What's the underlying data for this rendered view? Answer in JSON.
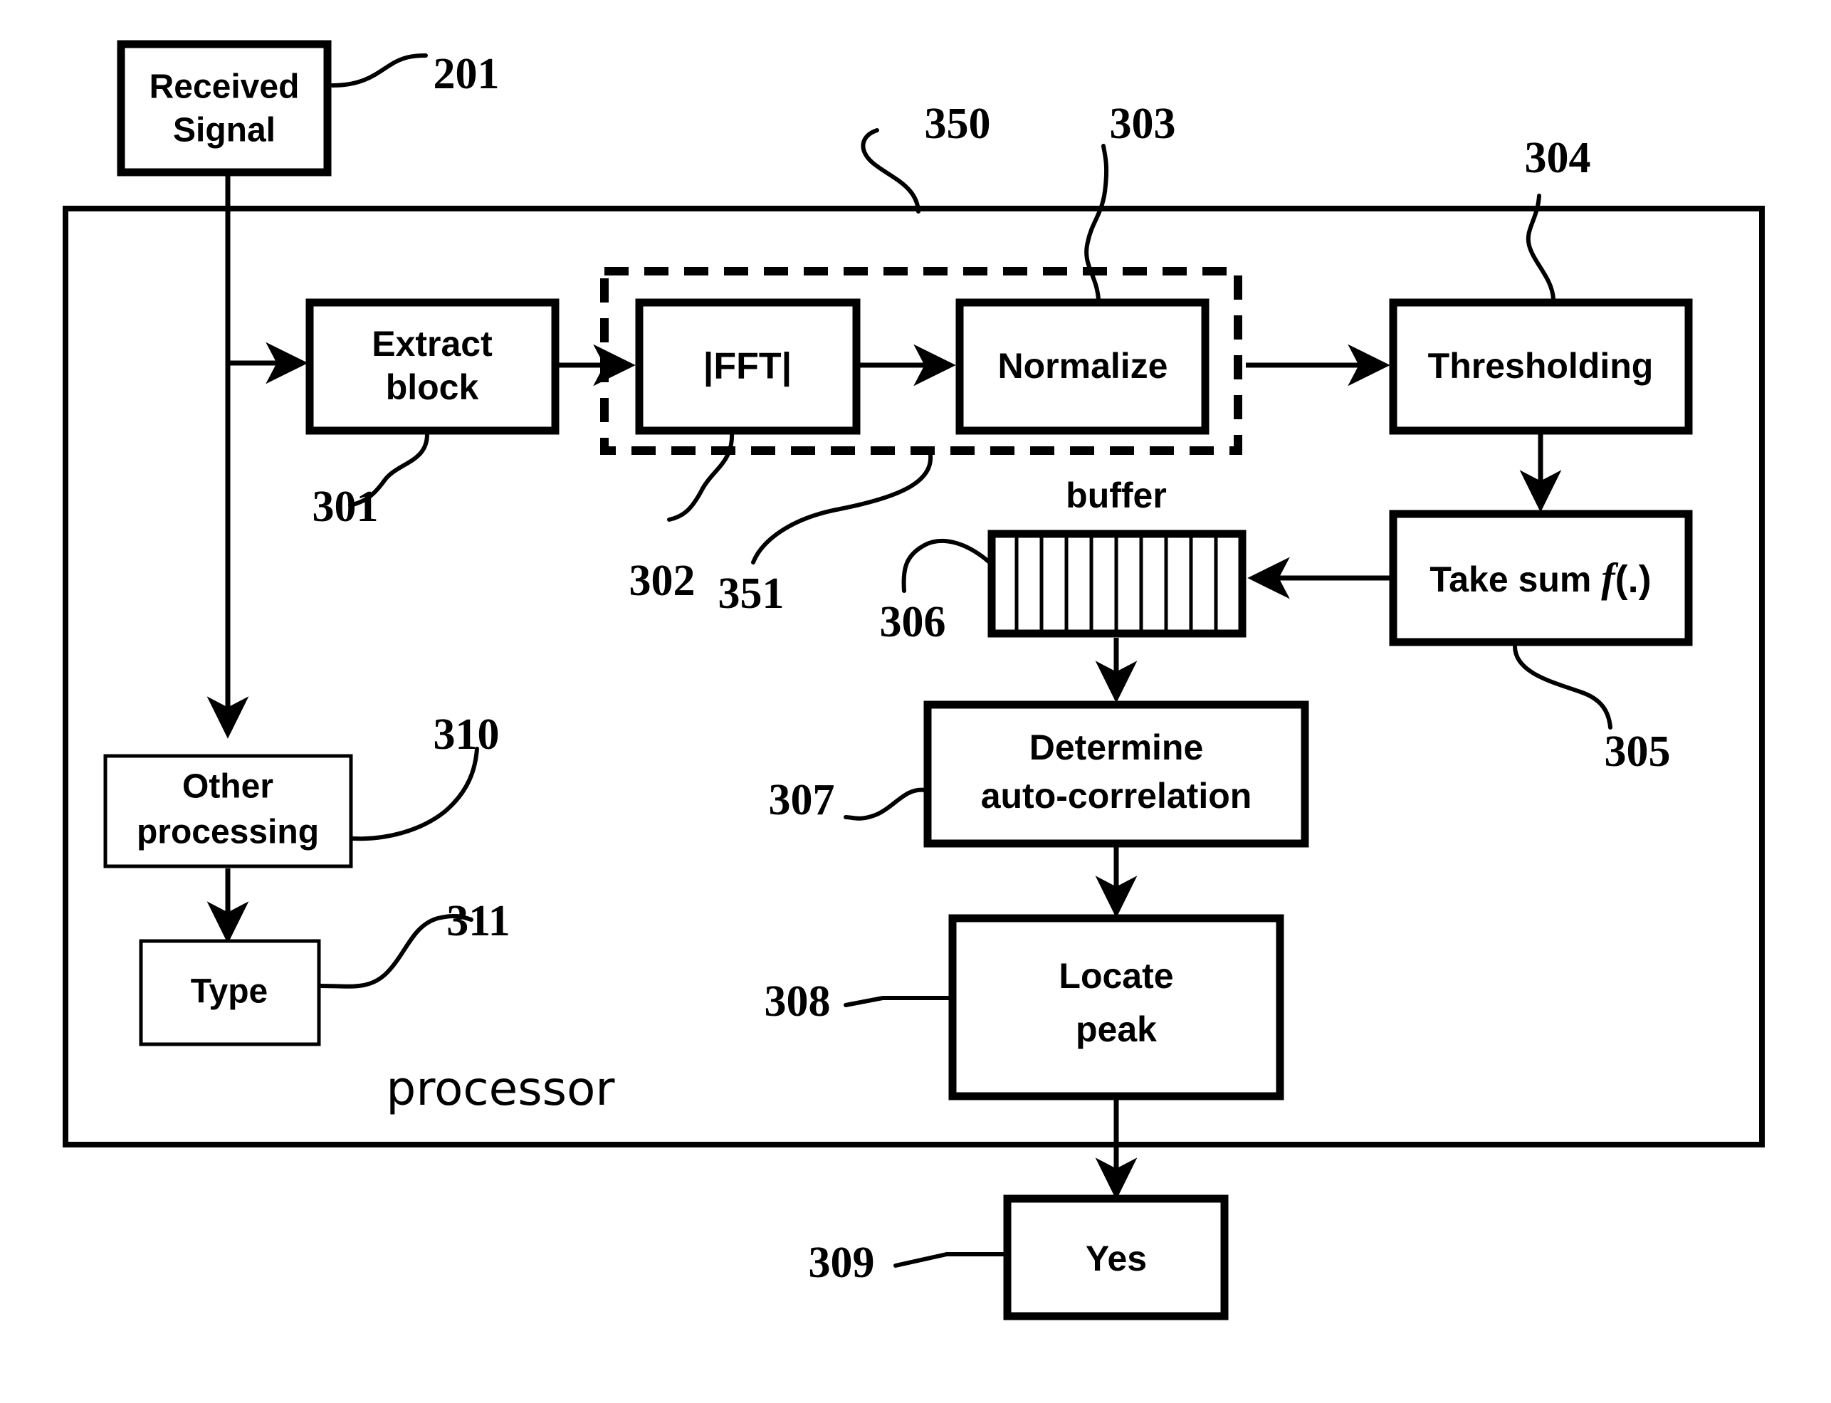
{
  "figure": {
    "type": "patent-flowchart",
    "container_label": "processor"
  },
  "blocks": {
    "received_signal": {
      "label_line1": "Received",
      "label_line2": "Signal"
    },
    "extract_block": {
      "label_line1": "Extract",
      "label_line2": "block"
    },
    "fft": {
      "label": "|FFT|"
    },
    "normalize": {
      "label": "Normalize"
    },
    "thresholding": {
      "label": "Thresholding"
    },
    "take_sum": {
      "label_prefix": "Take sum ",
      "label_italic": "f",
      "label_suffix": "(.)"
    },
    "buffer": {
      "caption": "buffer",
      "cells": 10
    },
    "determine_autocorrelation": {
      "label_line1": "Determine",
      "label_line2": "auto-correlation"
    },
    "locate_peak": {
      "label_line1": "Locate",
      "label_line2": "peak"
    },
    "yes": {
      "label": "Yes"
    },
    "other_processing": {
      "label_line1": "Other",
      "label_line2": "processing"
    },
    "type": {
      "label": "Type"
    }
  },
  "reference_numerals": {
    "n201": "201",
    "n301": "301",
    "n302": "302",
    "n303": "303",
    "n304": "304",
    "n305": "305",
    "n306": "306",
    "n307": "307",
    "n308": "308",
    "n309": "309",
    "n310": "310",
    "n311": "311",
    "n350": "350",
    "n351": "351"
  },
  "colors": {
    "stroke": "#000000",
    "fill": "#ffffff"
  }
}
